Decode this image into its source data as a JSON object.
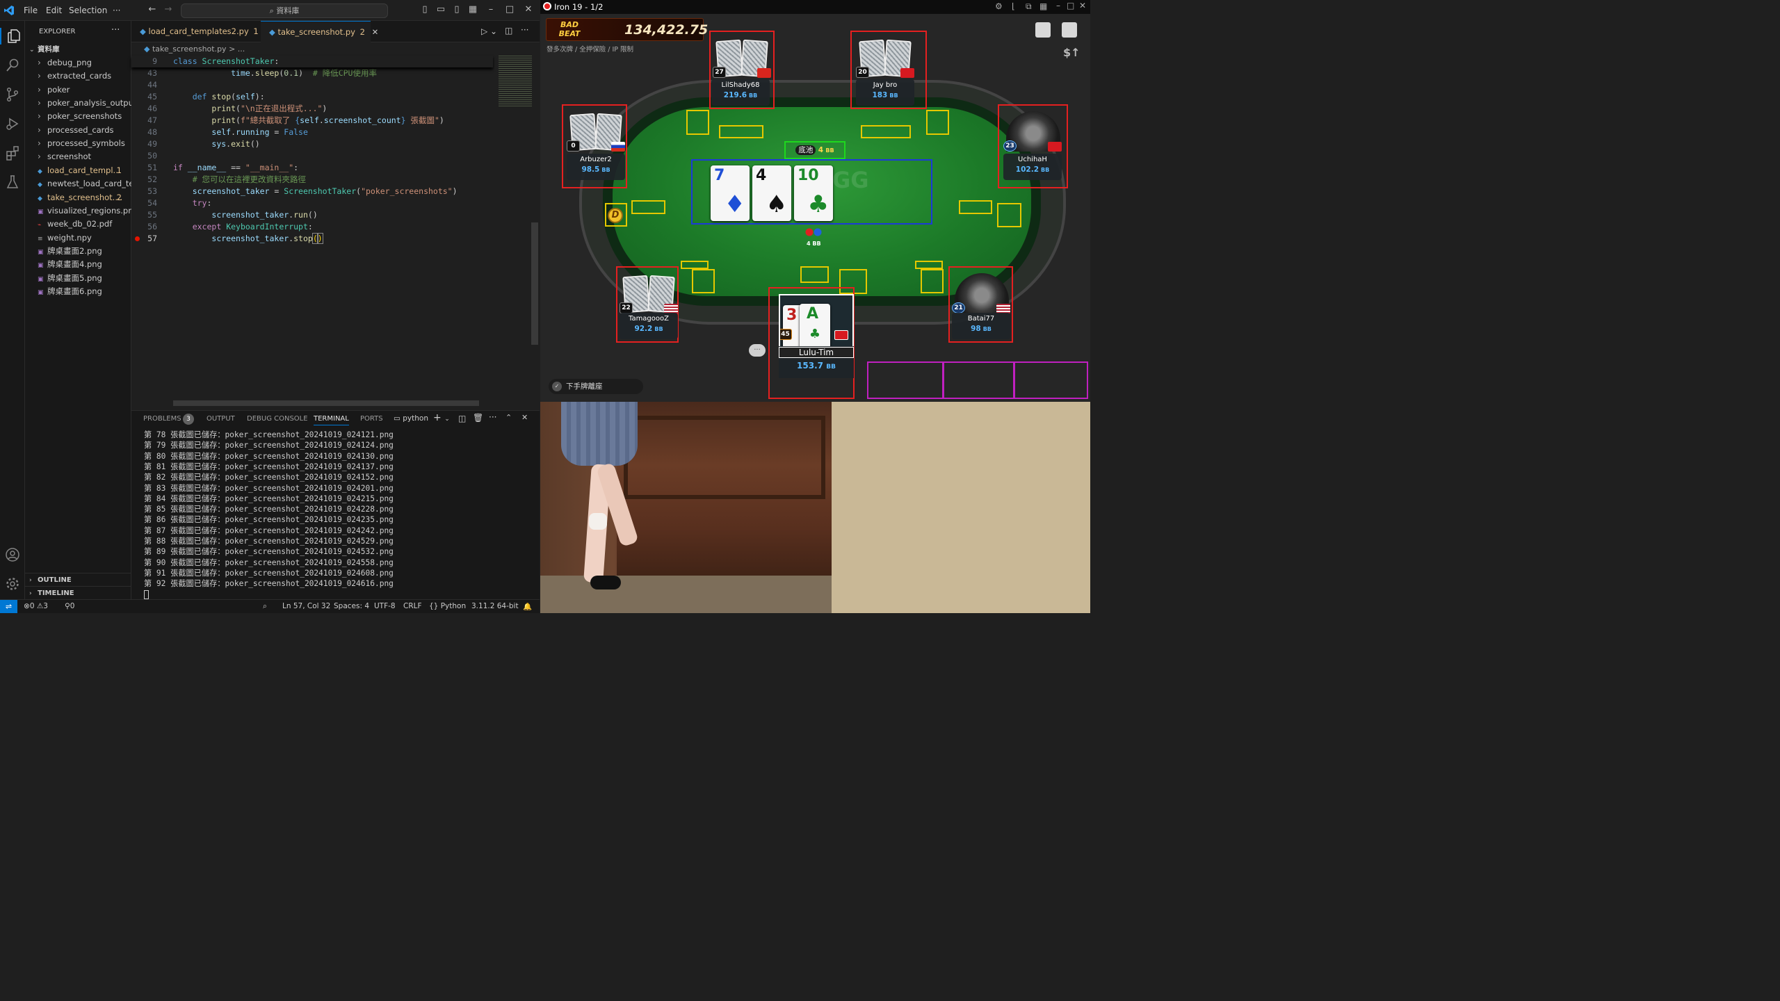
{
  "vscode": {
    "menu": [
      "File",
      "Edit",
      "Selection",
      "···"
    ],
    "search_placeholder": "資料庫",
    "explorer_title": "EXPLORER",
    "folder_name": "資料庫",
    "tree": [
      {
        "label": "debug_png",
        "type": "folder"
      },
      {
        "label": "extracted_cards",
        "type": "folder"
      },
      {
        "label": "poker",
        "type": "folder"
      },
      {
        "label": "poker_analysis_output",
        "type": "folder"
      },
      {
        "label": "poker_screenshots",
        "type": "folder"
      },
      {
        "label": "processed_cards",
        "type": "folder"
      },
      {
        "label": "processed_symbols",
        "type": "folder"
      },
      {
        "label": "screenshot",
        "type": "folder"
      },
      {
        "label": "load_card_templ...",
        "type": "py-modified",
        "badge": "1"
      },
      {
        "label": "newtest_load_card_te...",
        "type": "py"
      },
      {
        "label": "take_screenshot....",
        "type": "py-modified",
        "badge": "2"
      },
      {
        "label": "visualized_regions.png",
        "type": "img"
      },
      {
        "label": "week_db_02.pdf",
        "type": "pdf"
      },
      {
        "label": "weight.npy",
        "type": "file"
      },
      {
        "label": "牌桌畫面2.png",
        "type": "img"
      },
      {
        "label": "牌桌畫面4.png",
        "type": "img"
      },
      {
        "label": "牌桌畫面5.png",
        "type": "img"
      },
      {
        "label": "牌桌畫面6.png",
        "type": "img"
      }
    ],
    "outline": "OUTLINE",
    "timeline": "TIMELINE",
    "tabs": [
      {
        "label": "load_card_templates2.py",
        "badge": "1",
        "state": "modified"
      },
      {
        "label": "take_screenshot.py",
        "badge": "2",
        "state": "active"
      }
    ],
    "breadcrumb": "take_screenshot.py > ...",
    "sticky_line_no": "9",
    "sticky_code": "class ScreenshotTaker:",
    "line_numbers": [
      "43",
      "44",
      "45",
      "46",
      "47",
      "48",
      "49",
      "50",
      "51",
      "52",
      "53",
      "54",
      "55",
      "56",
      "57"
    ],
    "panel_tabs": [
      "PROBLEMS",
      "OUTPUT",
      "DEBUG CONSOLE",
      "TERMINAL",
      "PORTS"
    ],
    "problems_count": "3",
    "terminal_shell": "python",
    "terminal_lines": [
      "第 78 張截圖已儲存：poker_screenshot_20241019_024121.png",
      "第 79 張截圖已儲存：poker_screenshot_20241019_024124.png",
      "第 80 張截圖已儲存：poker_screenshot_20241019_024130.png",
      "第 81 張截圖已儲存：poker_screenshot_20241019_024137.png",
      "第 82 張截圖已儲存：poker_screenshot_20241019_024152.png",
      "第 83 張截圖已儲存：poker_screenshot_20241019_024201.png",
      "第 84 張截圖已儲存：poker_screenshot_20241019_024215.png",
      "第 85 張截圖已儲存：poker_screenshot_20241019_024228.png",
      "第 86 張截圖已儲存：poker_screenshot_20241019_024235.png",
      "第 87 張截圖已儲存：poker_screenshot_20241019_024242.png",
      "第 88 張截圖已儲存：poker_screenshot_20241019_024529.png",
      "第 89 張截圖已儲存：poker_screenshot_20241019_024532.png",
      "第 90 張截圖已儲存：poker_screenshot_20241019_024558.png",
      "第 91 張截圖已儲存：poker_screenshot_20241019_024608.png",
      "第 92 張截圖已儲存：poker_screenshot_20241019_024616.png"
    ],
    "status": {
      "errors": "0",
      "warnings": "3",
      "ports": "0",
      "position": "Ln 57, Col 32",
      "spaces": "Spaces: 4",
      "encoding": "UTF-8",
      "eol": "CRLF",
      "language": "Python",
      "interpreter": "3.11.2 64-bit"
    }
  },
  "poker": {
    "window_title": "Iron 19 - 1/2",
    "jackpot_logo": "BAD BEAT",
    "jackpot_amount": "134,422.75",
    "table_info": "發多次牌 / 全押保險 / IP 限制",
    "pot_label": "底池",
    "pot_value": "4",
    "pot_unit": "BB",
    "bet_chip": "4 BB",
    "dealer_button": "D",
    "sit_out_label": "下手牌離座",
    "board": [
      {
        "rank": "7",
        "suit": "♦",
        "color": "#1f4fd6"
      },
      {
        "rank": "4",
        "suit": "♠",
        "color": "#111111"
      },
      {
        "rank": "10",
        "suit": "♣",
        "color": "#1c8a2a"
      }
    ],
    "players": [
      {
        "name": "LilShady68",
        "stack": "219.6",
        "level": "27",
        "flag": "VN"
      },
      {
        "name": "Jay bro",
        "stack": "183",
        "level": "20",
        "flag": "TW"
      },
      {
        "name": "Arbuzer2",
        "stack": "98.5",
        "level": "0",
        "flag": "RU"
      },
      {
        "name": "UchihaH",
        "stack": "102.2",
        "level": "23",
        "flag": "TW"
      },
      {
        "name": "TamagoooZ",
        "stack": "92.2",
        "level": "22",
        "flag": "US"
      },
      {
        "name": "Batai77",
        "stack": "98",
        "level": "21",
        "flag": "US"
      },
      {
        "name": "Lulu-Tim",
        "stack": "153.7",
        "level": "45",
        "flag": "TW"
      }
    ],
    "hero_cards": [
      {
        "rank": "3",
        "color": "#c0201e"
      },
      {
        "rank": "A",
        "suit": "♣",
        "color": "#1c8a2a"
      }
    ],
    "bb": "BB"
  }
}
